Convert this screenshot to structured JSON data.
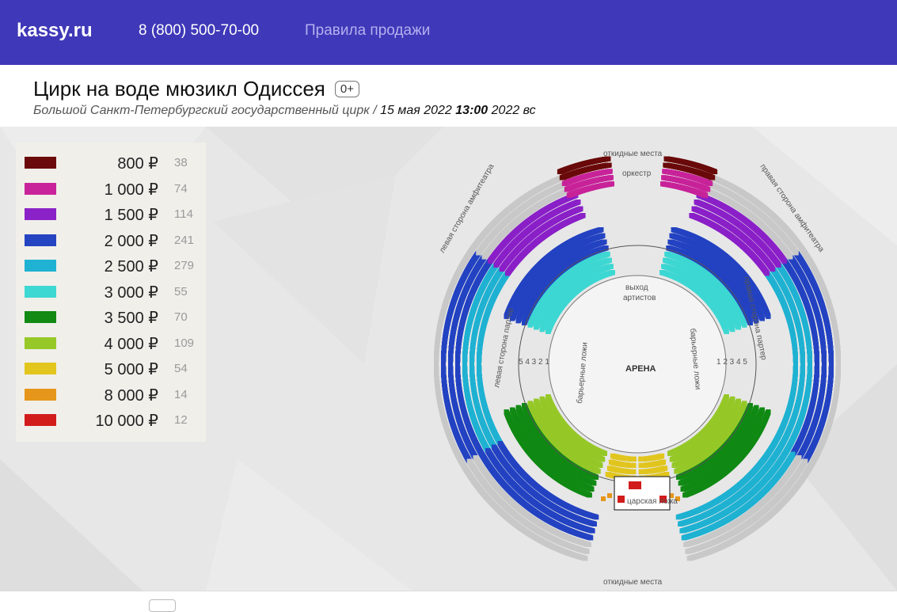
{
  "nav": {
    "logo": "kassy.ru",
    "phone": "8 (800) 500-70-00",
    "rules": "Правила продажи"
  },
  "event": {
    "title": "Цирк на воде мюзикл Одиссея",
    "age": "0+",
    "venue": "Большой Санкт-Петербургский государственный цирк",
    "separator": " / ",
    "date": "15 мая 2022",
    "time": "13:00",
    "tail": "2022 вс"
  },
  "legend": [
    {
      "price": "800 ₽",
      "count": "38",
      "color": "#6b0a0a"
    },
    {
      "price": "1 000 ₽",
      "count": "74",
      "color": "#c8239a"
    },
    {
      "price": "1 500 ₽",
      "count": "114",
      "color": "#8b22c8"
    },
    {
      "price": "2 000 ₽",
      "count": "241",
      "color": "#2444c2"
    },
    {
      "price": "2 500 ₽",
      "count": "279",
      "color": "#20b2d2"
    },
    {
      "price": "3 000 ₽",
      "count": "55",
      "color": "#3ed8d2"
    },
    {
      "price": "3 500 ₽",
      "count": "70",
      "color": "#128a14"
    },
    {
      "price": "4 000 ₽",
      "count": "109",
      "color": "#96c828"
    },
    {
      "price": "5 000 ₽",
      "count": "54",
      "color": "#e2c61e"
    },
    {
      "price": "8 000 ₽",
      "count": "14",
      "color": "#e6961a"
    },
    {
      "price": "10 000 ₽",
      "count": "12",
      "color": "#d21c1c"
    }
  ],
  "map": {
    "arena": "АРЕНА",
    "orchestra": "оркестр",
    "exit": "выход",
    "artists": "артистов",
    "top_free": "откидные места",
    "bottom_free": "откидные места",
    "left_amph": "левая сторона амфитеатра",
    "right_amph": "правая сторона амфитеатра",
    "left_parterre": "левая сторона партер",
    "right_parterre": "правая сторона партер",
    "left_boxes": "барьерные ложи",
    "right_boxes": "барьерные ложи",
    "left_box_nums": "5 4 3 2 1",
    "right_box_nums": "1 2 3 4 5",
    "gov_box": "царская ложа"
  }
}
